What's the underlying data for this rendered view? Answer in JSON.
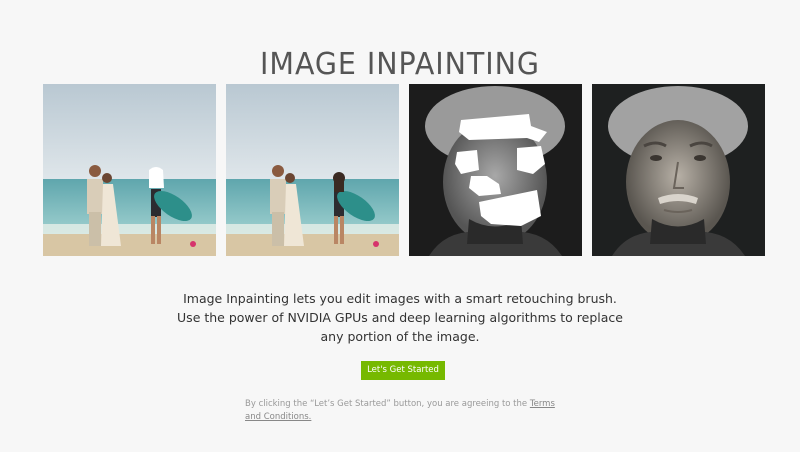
{
  "header": {
    "title": "IMAGE INPAINTING"
  },
  "gallery": {
    "items": [
      {
        "icon": "beach-couple-masked-image"
      },
      {
        "icon": "beach-couple-inpainted-image"
      },
      {
        "icon": "einstein-masked-image"
      },
      {
        "icon": "einstein-inpainted-image"
      }
    ]
  },
  "description": {
    "line1": "Image Inpainting lets you edit images with a smart retouching brush.",
    "line2": "Use the power of NVIDIA GPUs and deep learning algorithms to replace",
    "line3": "any portion of the image."
  },
  "cta": {
    "label": "Let's Get Started"
  },
  "terms": {
    "prefix": "By clicking the “Let’s Get Started” button, you are agreeing to the ",
    "link": "Terms and Conditions."
  },
  "colors": {
    "accent": "#76b900",
    "title": "#555555",
    "background": "#f7f7f7"
  }
}
